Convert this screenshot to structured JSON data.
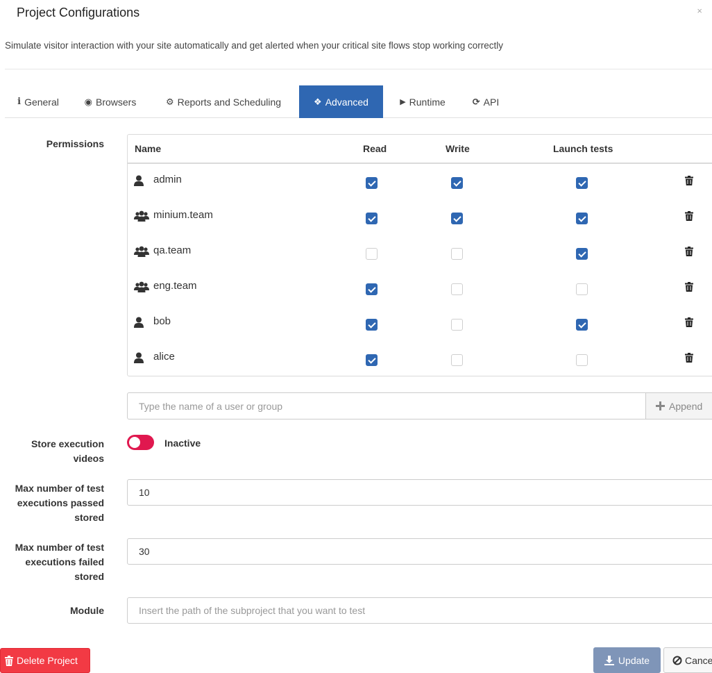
{
  "modal": {
    "title": "Project Configurations",
    "close_glyph": "×",
    "subtitle": "Simulate visitor interaction with your site automatically and get alerted when your critical site flows stop working correctly"
  },
  "tabs": [
    {
      "label": "General",
      "icon": "info-icon",
      "glyph": "i",
      "active": false
    },
    {
      "label": "Browsers",
      "icon": "globe-icon",
      "glyph": "◉",
      "active": false
    },
    {
      "label": "Reports and Scheduling",
      "icon": "cogs-icon",
      "glyph": "⚙",
      "active": false
    },
    {
      "label": "Advanced",
      "icon": "cubes-icon",
      "glyph": "❖",
      "active": true
    },
    {
      "label": "Runtime",
      "icon": "play-icon",
      "glyph": "▶",
      "active": false
    },
    {
      "label": "API",
      "icon": "refresh-icon",
      "glyph": "⟳",
      "active": false
    }
  ],
  "permissions": {
    "label": "Permissions",
    "columns": {
      "name": "Name",
      "read": "Read",
      "write": "Write",
      "launch": "Launch tests"
    },
    "rows": [
      {
        "name": "admin",
        "type": "user",
        "read": true,
        "write": true,
        "launch": true
      },
      {
        "name": "minium.team",
        "type": "group",
        "read": true,
        "write": true,
        "launch": true
      },
      {
        "name": "qa.team",
        "type": "group",
        "read": false,
        "write": false,
        "launch": true
      },
      {
        "name": "eng.team",
        "type": "group",
        "read": true,
        "write": false,
        "launch": false
      },
      {
        "name": "bob",
        "type": "user",
        "read": true,
        "write": false,
        "launch": true
      },
      {
        "name": "alice",
        "type": "user",
        "read": true,
        "write": false,
        "launch": false
      }
    ],
    "append_placeholder": "Type the name of a user or group",
    "append_label": "Append"
  },
  "store_videos": {
    "label_line1": "Store execution",
    "label_line2": "videos",
    "state_label": "Inactive",
    "enabled": false
  },
  "max_passed": {
    "label_line1": "Max number of test",
    "label_line2": "executions passed",
    "label_line3": "stored",
    "value": "10"
  },
  "max_failed": {
    "label_line1": "Max number of test",
    "label_line2": "executions failed",
    "label_line3": "stored",
    "value": "30"
  },
  "module": {
    "label": "Module",
    "placeholder": "Insert the path of the subproject that you want to test"
  },
  "footer": {
    "delete_label": "Delete Project",
    "update_label": "Update",
    "cancel_label": "Cance"
  },
  "colors": {
    "primary": "#2f67b2",
    "danger": "#f23a44",
    "toggle_off": "#e0184f",
    "update_disabled": "#7f95b8"
  }
}
